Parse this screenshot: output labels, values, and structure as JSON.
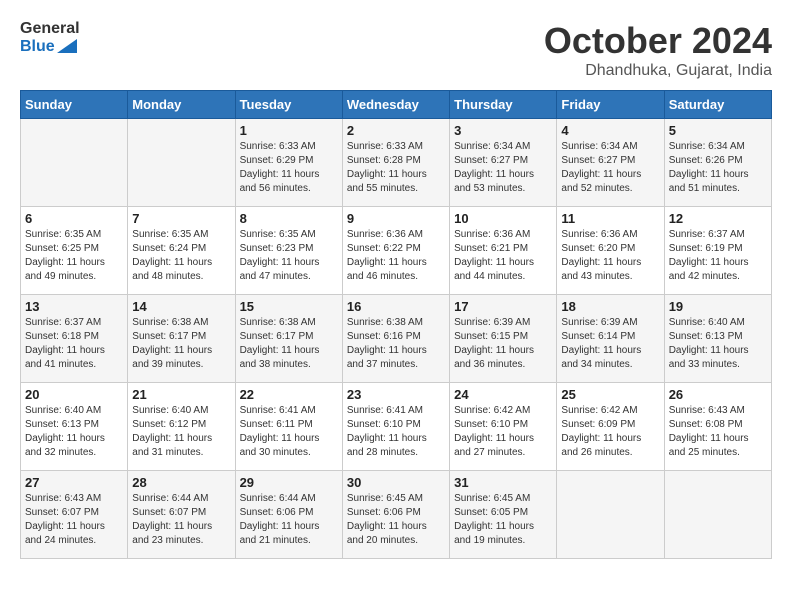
{
  "header": {
    "logo_general": "General",
    "logo_blue": "Blue",
    "month": "October 2024",
    "location": "Dhandhuka, Gujarat, India"
  },
  "days_of_week": [
    "Sunday",
    "Monday",
    "Tuesday",
    "Wednesday",
    "Thursday",
    "Friday",
    "Saturday"
  ],
  "weeks": [
    [
      {
        "day": "",
        "sunrise": "",
        "sunset": "",
        "daylight": ""
      },
      {
        "day": "",
        "sunrise": "",
        "sunset": "",
        "daylight": ""
      },
      {
        "day": "1",
        "sunrise": "Sunrise: 6:33 AM",
        "sunset": "Sunset: 6:29 PM",
        "daylight": "Daylight: 11 hours and 56 minutes."
      },
      {
        "day": "2",
        "sunrise": "Sunrise: 6:33 AM",
        "sunset": "Sunset: 6:28 PM",
        "daylight": "Daylight: 11 hours and 55 minutes."
      },
      {
        "day": "3",
        "sunrise": "Sunrise: 6:34 AM",
        "sunset": "Sunset: 6:27 PM",
        "daylight": "Daylight: 11 hours and 53 minutes."
      },
      {
        "day": "4",
        "sunrise": "Sunrise: 6:34 AM",
        "sunset": "Sunset: 6:27 PM",
        "daylight": "Daylight: 11 hours and 52 minutes."
      },
      {
        "day": "5",
        "sunrise": "Sunrise: 6:34 AM",
        "sunset": "Sunset: 6:26 PM",
        "daylight": "Daylight: 11 hours and 51 minutes."
      }
    ],
    [
      {
        "day": "6",
        "sunrise": "Sunrise: 6:35 AM",
        "sunset": "Sunset: 6:25 PM",
        "daylight": "Daylight: 11 hours and 49 minutes."
      },
      {
        "day": "7",
        "sunrise": "Sunrise: 6:35 AM",
        "sunset": "Sunset: 6:24 PM",
        "daylight": "Daylight: 11 hours and 48 minutes."
      },
      {
        "day": "8",
        "sunrise": "Sunrise: 6:35 AM",
        "sunset": "Sunset: 6:23 PM",
        "daylight": "Daylight: 11 hours and 47 minutes."
      },
      {
        "day": "9",
        "sunrise": "Sunrise: 6:36 AM",
        "sunset": "Sunset: 6:22 PM",
        "daylight": "Daylight: 11 hours and 46 minutes."
      },
      {
        "day": "10",
        "sunrise": "Sunrise: 6:36 AM",
        "sunset": "Sunset: 6:21 PM",
        "daylight": "Daylight: 11 hours and 44 minutes."
      },
      {
        "day": "11",
        "sunrise": "Sunrise: 6:36 AM",
        "sunset": "Sunset: 6:20 PM",
        "daylight": "Daylight: 11 hours and 43 minutes."
      },
      {
        "day": "12",
        "sunrise": "Sunrise: 6:37 AM",
        "sunset": "Sunset: 6:19 PM",
        "daylight": "Daylight: 11 hours and 42 minutes."
      }
    ],
    [
      {
        "day": "13",
        "sunrise": "Sunrise: 6:37 AM",
        "sunset": "Sunset: 6:18 PM",
        "daylight": "Daylight: 11 hours and 41 minutes."
      },
      {
        "day": "14",
        "sunrise": "Sunrise: 6:38 AM",
        "sunset": "Sunset: 6:17 PM",
        "daylight": "Daylight: 11 hours and 39 minutes."
      },
      {
        "day": "15",
        "sunrise": "Sunrise: 6:38 AM",
        "sunset": "Sunset: 6:17 PM",
        "daylight": "Daylight: 11 hours and 38 minutes."
      },
      {
        "day": "16",
        "sunrise": "Sunrise: 6:38 AM",
        "sunset": "Sunset: 6:16 PM",
        "daylight": "Daylight: 11 hours and 37 minutes."
      },
      {
        "day": "17",
        "sunrise": "Sunrise: 6:39 AM",
        "sunset": "Sunset: 6:15 PM",
        "daylight": "Daylight: 11 hours and 36 minutes."
      },
      {
        "day": "18",
        "sunrise": "Sunrise: 6:39 AM",
        "sunset": "Sunset: 6:14 PM",
        "daylight": "Daylight: 11 hours and 34 minutes."
      },
      {
        "day": "19",
        "sunrise": "Sunrise: 6:40 AM",
        "sunset": "Sunset: 6:13 PM",
        "daylight": "Daylight: 11 hours and 33 minutes."
      }
    ],
    [
      {
        "day": "20",
        "sunrise": "Sunrise: 6:40 AM",
        "sunset": "Sunset: 6:13 PM",
        "daylight": "Daylight: 11 hours and 32 minutes."
      },
      {
        "day": "21",
        "sunrise": "Sunrise: 6:40 AM",
        "sunset": "Sunset: 6:12 PM",
        "daylight": "Daylight: 11 hours and 31 minutes."
      },
      {
        "day": "22",
        "sunrise": "Sunrise: 6:41 AM",
        "sunset": "Sunset: 6:11 PM",
        "daylight": "Daylight: 11 hours and 30 minutes."
      },
      {
        "day": "23",
        "sunrise": "Sunrise: 6:41 AM",
        "sunset": "Sunset: 6:10 PM",
        "daylight": "Daylight: 11 hours and 28 minutes."
      },
      {
        "day": "24",
        "sunrise": "Sunrise: 6:42 AM",
        "sunset": "Sunset: 6:10 PM",
        "daylight": "Daylight: 11 hours and 27 minutes."
      },
      {
        "day": "25",
        "sunrise": "Sunrise: 6:42 AM",
        "sunset": "Sunset: 6:09 PM",
        "daylight": "Daylight: 11 hours and 26 minutes."
      },
      {
        "day": "26",
        "sunrise": "Sunrise: 6:43 AM",
        "sunset": "Sunset: 6:08 PM",
        "daylight": "Daylight: 11 hours and 25 minutes."
      }
    ],
    [
      {
        "day": "27",
        "sunrise": "Sunrise: 6:43 AM",
        "sunset": "Sunset: 6:07 PM",
        "daylight": "Daylight: 11 hours and 24 minutes."
      },
      {
        "day": "28",
        "sunrise": "Sunrise: 6:44 AM",
        "sunset": "Sunset: 6:07 PM",
        "daylight": "Daylight: 11 hours and 23 minutes."
      },
      {
        "day": "29",
        "sunrise": "Sunrise: 6:44 AM",
        "sunset": "Sunset: 6:06 PM",
        "daylight": "Daylight: 11 hours and 21 minutes."
      },
      {
        "day": "30",
        "sunrise": "Sunrise: 6:45 AM",
        "sunset": "Sunset: 6:06 PM",
        "daylight": "Daylight: 11 hours and 20 minutes."
      },
      {
        "day": "31",
        "sunrise": "Sunrise: 6:45 AM",
        "sunset": "Sunset: 6:05 PM",
        "daylight": "Daylight: 11 hours and 19 minutes."
      },
      {
        "day": "",
        "sunrise": "",
        "sunset": "",
        "daylight": ""
      },
      {
        "day": "",
        "sunrise": "",
        "sunset": "",
        "daylight": ""
      }
    ]
  ]
}
